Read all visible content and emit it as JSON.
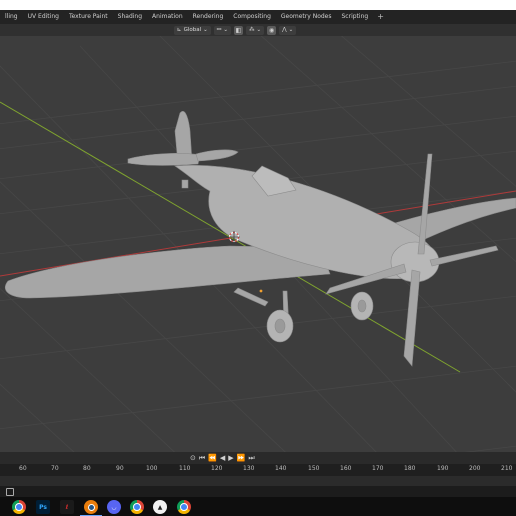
{
  "workspace_tabs": [
    "lling",
    "UV Editing",
    "Texture Paint",
    "Shading",
    "Animation",
    "Rendering",
    "Compositing",
    "Geometry Nodes",
    "Scripting",
    "+"
  ],
  "header": {
    "transform_orientation": "Global",
    "icons": [
      "orientation-icon",
      "chevron-down-icon",
      "link-icon",
      "chevron-down-icon",
      "snap-icon",
      "snap-target-icon",
      "chevron-down-icon",
      "proportional-icon",
      "falloff-icon",
      "chevron-down-icon"
    ]
  },
  "playback": {
    "controls": [
      "⊙",
      "⏮",
      "⏪",
      "◀",
      "▶",
      "⏩",
      "⏭"
    ]
  },
  "timeline": {
    "ticks": [
      "60",
      "70",
      "80",
      "90",
      "100",
      "110",
      "120",
      "130",
      "140",
      "150",
      "160",
      "170",
      "180",
      "190",
      "200",
      "210"
    ]
  },
  "taskbar": {
    "apps": [
      {
        "name": "chrome-icon",
        "label": ""
      },
      {
        "name": "photoshop-icon",
        "label": "Ps"
      },
      {
        "name": "acrobat-icon",
        "label": ""
      },
      {
        "name": "blender-icon",
        "label": ""
      },
      {
        "name": "discord-icon",
        "label": ""
      },
      {
        "name": "chrome-icon-2",
        "label": ""
      },
      {
        "name": "inkscape-icon",
        "label": ""
      },
      {
        "name": "chrome-icon-3",
        "label": ""
      }
    ]
  },
  "colors": {
    "viewport_bg": "#3d3d3d",
    "grid_line": "#4a4a4a",
    "x_axis": "#b03a3a",
    "y_axis": "#7fa32f",
    "model": "#a6a6a6"
  }
}
